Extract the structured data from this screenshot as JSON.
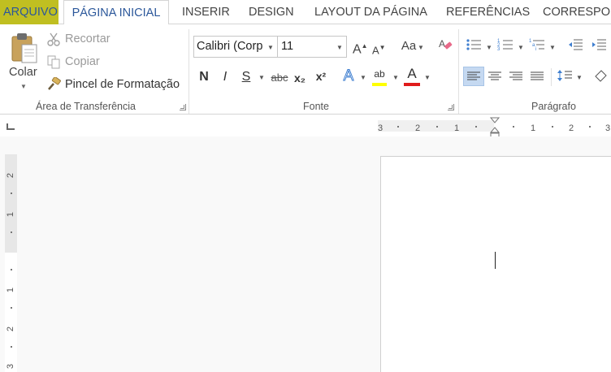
{
  "tabs": {
    "file": "ARQUIVO",
    "home": "PÁGINA INICIAL",
    "insert": "INSERIR",
    "design": "DESIGN",
    "layout": "LAYOUT DA PÁGINA",
    "references": "REFERÊNCIAS",
    "mailings": "CORRESPON"
  },
  "clipboard": {
    "paste": "Colar",
    "cut": "Recortar",
    "copy": "Copiar",
    "format_painter": "Pincel de Formatação",
    "group_label": "Área de Transferência"
  },
  "font": {
    "name": "Calibri (Corp",
    "size": "11",
    "bold": "N",
    "italic": "I",
    "underline": "S",
    "strikethrough": "abc",
    "subscript": "x₂",
    "superscript": "x²",
    "grow": "A",
    "shrink": "A",
    "change_case": "Aa",
    "text_effects": "A",
    "highlight": "ab",
    "font_color": "A",
    "group_label": "Fonte"
  },
  "paragraph": {
    "group_label": "Parágrafo"
  },
  "ruler": {
    "h_numbers": [
      "3",
      "2",
      "1",
      "1",
      "2",
      "3"
    ],
    "v_numbers": [
      "2",
      "1",
      "1",
      "2",
      "3"
    ]
  },
  "colors": {
    "file_tab_bg": "#c0bf21",
    "accent": "#2b579a",
    "highlight_yellow": "#ffff00",
    "font_red": "#e01b1b",
    "active_button_bg": "#c5d9f1"
  },
  "icons": {
    "paste": "clipboard-icon",
    "cut": "scissors-icon",
    "copy": "copy-icon",
    "format_painter": "brush-icon",
    "clear_format": "eraser-icon"
  }
}
